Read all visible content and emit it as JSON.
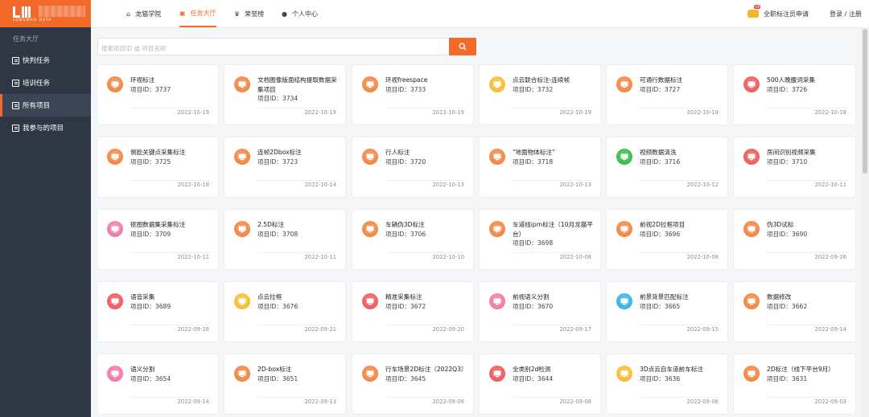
{
  "brand": {
    "sub": "LONGMAO DATA"
  },
  "sidebar": {
    "section": "任务大厅",
    "items": [
      {
        "label": "快判任务",
        "icon": "image-icon"
      },
      {
        "label": "培训任务",
        "icon": "training-icon"
      },
      {
        "label": "所有项目",
        "icon": "clipboard-icon",
        "active": true
      },
      {
        "label": "我参与的项目",
        "icon": "document-icon"
      }
    ]
  },
  "topnav": [
    {
      "label": "龙猫学院",
      "icon": "home-icon"
    },
    {
      "label": "任务大厅",
      "icon": "briefcase-icon",
      "active": true
    },
    {
      "label": "荣誉榜",
      "icon": "trophy-icon"
    },
    {
      "label": "个人中心",
      "icon": "user-icon"
    }
  ],
  "header": {
    "apply": "全职标注员申请",
    "login": "登录 / 注册"
  },
  "search": {
    "placeholder": "搜索项目ID 或 项目名称"
  },
  "id_prefix": "项目ID：",
  "colors": {
    "accent": "#f26b2a",
    "sidebar": "#2f3745"
  },
  "projects": [
    {
      "title": "环视标注",
      "id": "3737",
      "date": "2022-10-19",
      "icon": "orange"
    },
    {
      "title": "文档图像版面结构提取数据采集项目",
      "id": "3734",
      "date": "2022-10-19",
      "icon": "orange"
    },
    {
      "title": "环视freespace",
      "id": "3733",
      "date": "2022-10-19",
      "icon": "orange"
    },
    {
      "title": "点云联合标注-连续帧",
      "id": "3732",
      "date": "2022-10-19",
      "icon": "yellow"
    },
    {
      "title": "可通行数据标注",
      "id": "3727",
      "date": "2022-10-18",
      "icon": "orange"
    },
    {
      "title": "500人晚腹词采集",
      "id": "3726",
      "date": "2022-10-18",
      "icon": "red"
    },
    {
      "title": "侧脸关键点采集标注",
      "id": "3725",
      "date": "2022-10-18",
      "icon": "orange"
    },
    {
      "title": "连帧2Dbox标注",
      "id": "3723",
      "date": "2022-10-14",
      "icon": "orange"
    },
    {
      "title": "行人标注",
      "id": "3720",
      "date": "2022-10-13",
      "icon": "orange"
    },
    {
      "title": "\"地面物体标注\"",
      "id": "3718",
      "date": "2022-10-13",
      "icon": "orange"
    },
    {
      "title": "视频数据清洗",
      "id": "3716",
      "date": "2022-10-12",
      "icon": "green"
    },
    {
      "title": "房间识别视频采集",
      "id": "3710",
      "date": "2022-10-11",
      "icon": "red"
    },
    {
      "title": "抠图数据集采集标注",
      "id": "3709",
      "date": "2022-10-11",
      "icon": "pink"
    },
    {
      "title": "2.5D标注",
      "id": "3708",
      "date": "2022-10-11",
      "icon": "orange"
    },
    {
      "title": "车辆伪3D标注",
      "id": "3706",
      "date": "2022-10-10",
      "icon": "orange"
    },
    {
      "title": "车道线ipm标注（10月龙猫平台）",
      "id": "3698",
      "date": "2022-10-08",
      "icon": "orange"
    },
    {
      "title": "前视2D拉框项目",
      "id": "3696",
      "date": "2022-10-08",
      "icon": "orange"
    },
    {
      "title": "伪3D试标",
      "id": "3690",
      "date": "2022-09-26",
      "icon": "orange"
    },
    {
      "title": "语音采集",
      "id": "3689",
      "date": "2022-09-28",
      "icon": "red"
    },
    {
      "title": "点云拉框",
      "id": "3676",
      "date": "2022-09-21",
      "icon": "yellow"
    },
    {
      "title": "精准采集标注",
      "id": "3672",
      "date": "2022-09-20",
      "icon": "red"
    },
    {
      "title": "前视语义分割",
      "id": "3670",
      "date": "2022-09-17",
      "icon": "pink"
    },
    {
      "title": "前景背景匹配标注",
      "id": "3665",
      "date": "2022-09-15",
      "icon": "blue"
    },
    {
      "title": "数据修改",
      "id": "3662",
      "date": "2022-09-14",
      "icon": "orange"
    },
    {
      "title": "语义分割",
      "id": "3654",
      "date": "2022-09-14",
      "icon": "pink"
    },
    {
      "title": "2D-box标注",
      "id": "3651",
      "date": "2022-09-13",
      "icon": "orange"
    },
    {
      "title": "行车场景2D标注（2022Q3）",
      "id": "3645",
      "date": "2022-09-08",
      "icon": "orange"
    },
    {
      "title": "全类别2d检测",
      "id": "3644",
      "date": "2022-09-08",
      "icon": "red"
    },
    {
      "title": "3D点云自车道前车标注",
      "id": "3636",
      "date": "2022-09-06",
      "icon": "yellow"
    },
    {
      "title": "2D标注（线下平台9月）",
      "id": "3631",
      "date": "2022-09-03",
      "icon": "orange"
    }
  ]
}
